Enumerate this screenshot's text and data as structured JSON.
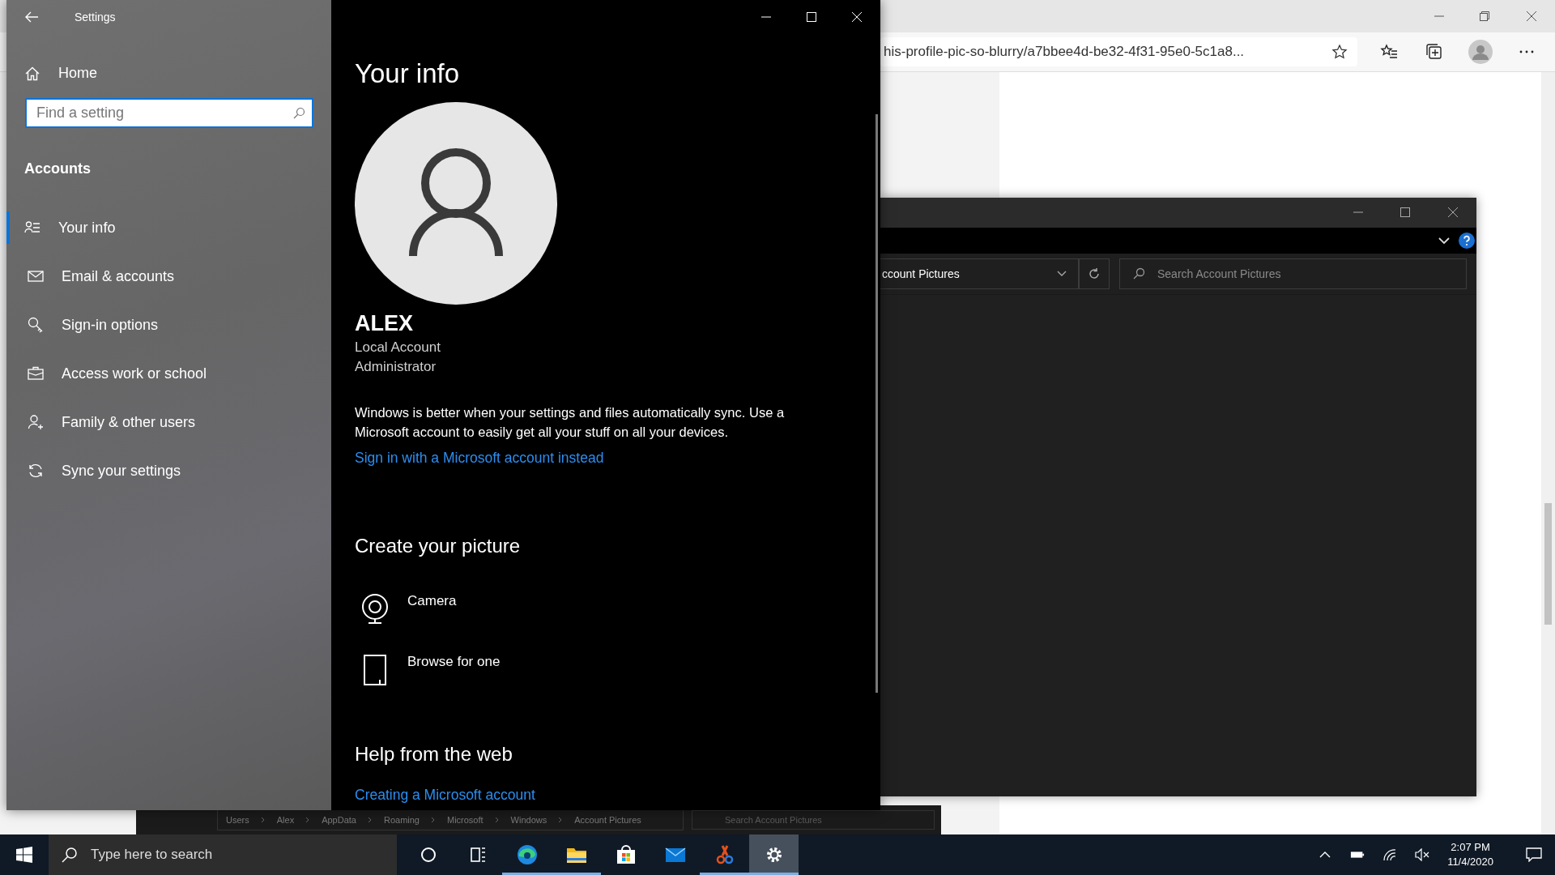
{
  "browser": {
    "url": "his-profile-pic-so-blurry/a7bbee4d-be32-4f31-95e0-5c1a8..."
  },
  "picture_dialog": {
    "location": "ccount Pictures",
    "search_placeholder": "Search Account Pictures"
  },
  "background_explorer": {
    "breadcrumb": [
      "Users",
      "Alex",
      "AppData",
      "Roaming",
      "Microsoft",
      "Windows",
      "Account Pictures"
    ],
    "search_placeholder": "Search Account Pictures"
  },
  "settings": {
    "title": "Settings",
    "home": "Home",
    "search_placeholder": "Find a setting",
    "section": "Accounts",
    "nav": [
      {
        "kind": "info",
        "label": "Your info",
        "selected": true
      },
      {
        "kind": "mail",
        "label": "Email & accounts",
        "selected": false
      },
      {
        "kind": "key",
        "label": "Sign-in options",
        "selected": false
      },
      {
        "kind": "briefcase",
        "label": "Access work or school",
        "selected": false
      },
      {
        "kind": "family",
        "label": "Family & other users",
        "selected": false
      },
      {
        "kind": "sync",
        "label": "Sync your settings",
        "selected": false
      }
    ],
    "page": {
      "title": "Your info",
      "name": "ALEX",
      "account_type": "Local Account",
      "role": "Administrator",
      "description": "Windows is better when your settings and files automatically sync. Use a Microsoft account to easily get all your stuff on all your devices.",
      "sign_in_link": "Sign in with a Microsoft account instead",
      "create_heading": "Create your picture",
      "options": [
        {
          "kind": "camera",
          "label": "Camera"
        },
        {
          "kind": "browse",
          "label": "Browse for one"
        }
      ],
      "help_heading": "Help from the web",
      "help_link": "Creating a Microsoft account"
    }
  },
  "taskbar": {
    "search_placeholder": "Type here to search",
    "apps": [
      {
        "kind": "cortana",
        "running": false,
        "active": false
      },
      {
        "kind": "taskview",
        "running": false,
        "active": false
      },
      {
        "kind": "edge",
        "running": true,
        "active": false
      },
      {
        "kind": "explorer",
        "running": true,
        "active": false
      },
      {
        "kind": "store",
        "running": false,
        "active": false
      },
      {
        "kind": "mail",
        "running": false,
        "active": false
      },
      {
        "kind": "snip",
        "running": true,
        "active": false
      },
      {
        "kind": "settings",
        "running": true,
        "active": true
      }
    ],
    "time": "2:07 PM",
    "date": "11/4/2020"
  }
}
